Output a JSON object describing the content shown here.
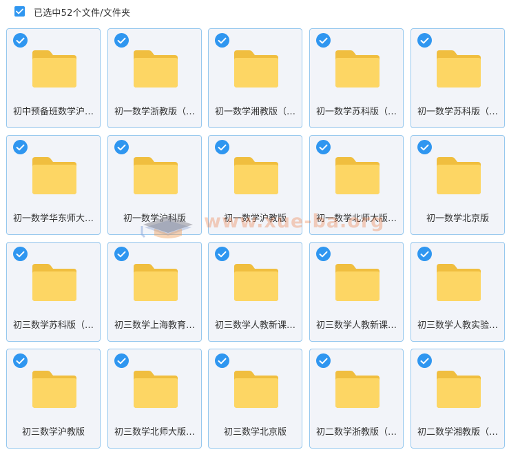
{
  "header": {
    "selection_label": "已选中52个文件/文件夹"
  },
  "colors": {
    "accent": "#2f96f0",
    "card_border": "#96c8ee",
    "card_background": "#f2f4f9",
    "folder_body": "#fdd664",
    "folder_tab": "#f0be3f"
  },
  "icons": {
    "selected": "check-circle-icon",
    "folder": "folder-icon"
  },
  "files": [
    {
      "name": "初中预备班数学沪…",
      "selected": true
    },
    {
      "name": "初一数学浙教版（…",
      "selected": true
    },
    {
      "name": "初一数学湘教版（…",
      "selected": true
    },
    {
      "name": "初一数学苏科版（…",
      "selected": true
    },
    {
      "name": "初一数学苏科版（…",
      "selected": true
    },
    {
      "name": "初一数学华东师大…",
      "selected": true
    },
    {
      "name": "初一数学沪科版",
      "selected": true
    },
    {
      "name": "初一数学沪教版",
      "selected": true
    },
    {
      "name": "初一数学北师大版…",
      "selected": true
    },
    {
      "name": "初一数学北京版",
      "selected": true
    },
    {
      "name": "初三数学苏科版（…",
      "selected": true
    },
    {
      "name": "初三数学上海教育…",
      "selected": true
    },
    {
      "name": "初三数学人教新课…",
      "selected": true
    },
    {
      "name": "初三数学人教新课…",
      "selected": true
    },
    {
      "name": "初三数学人教实验…",
      "selected": true
    },
    {
      "name": "初三数学沪教版",
      "selected": true
    },
    {
      "name": "初三数学北师大版…",
      "selected": true
    },
    {
      "name": "初三数学北京版",
      "selected": true
    },
    {
      "name": "初二数学浙教版（…",
      "selected": true
    },
    {
      "name": "初二数学湘教版（…",
      "selected": true
    }
  ],
  "watermark": {
    "text": "www.xue-ba.org",
    "logo": "graduation-cap-icon"
  }
}
